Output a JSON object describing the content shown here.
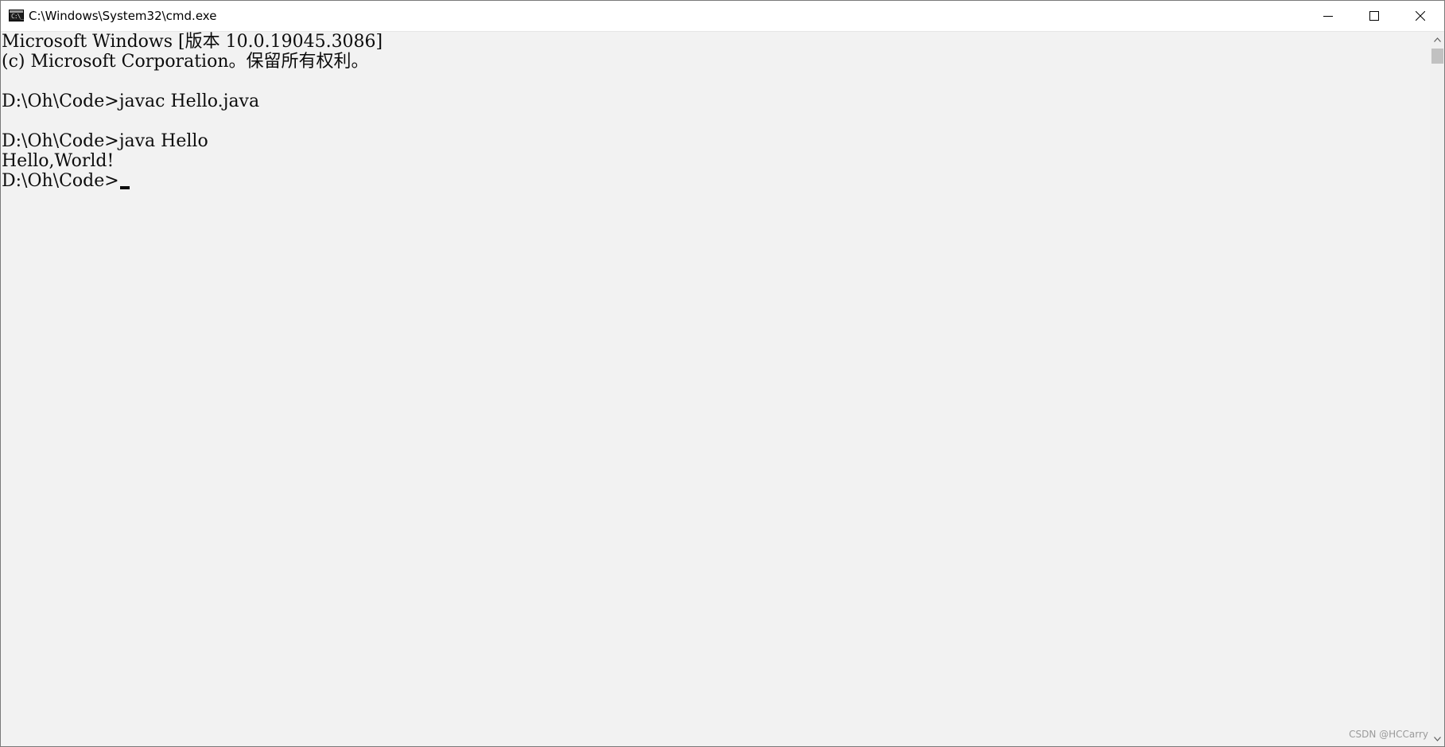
{
  "window": {
    "title": "C:\\Windows\\System32\\cmd.exe",
    "app_icon_glyph": "C:\\_",
    "icons": {
      "minimize": "minimize-icon",
      "maximize": "maximize-icon",
      "close": "close-icon"
    }
  },
  "console": {
    "lines": [
      "Microsoft Windows [版本 10.0.19045.3086]",
      "(c) Microsoft Corporation。保留所有权利。",
      "",
      "D:\\Oh\\Code>javac Hello.java",
      "",
      "D:\\Oh\\Code>java Hello",
      "Hello,World!",
      "D:\\Oh\\Code>"
    ],
    "text_color": "#0c0c0c",
    "background_color": "#f2f2f2"
  },
  "watermark": "CSDN @HCCarry"
}
